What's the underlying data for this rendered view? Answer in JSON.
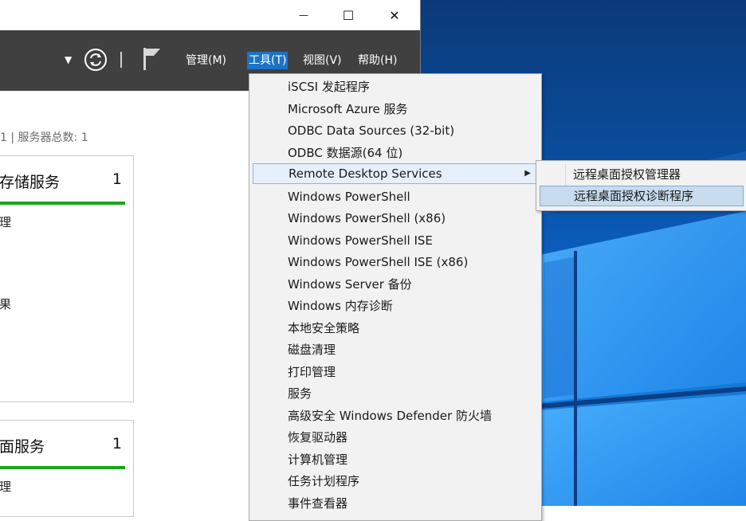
{
  "window": {
    "caption": {
      "minimize": "—",
      "maximize": "☐",
      "close": "✕"
    },
    "toolbar": {
      "dropdown_arrow": "▼",
      "menus": [
        "管理(M)",
        "工具(T)",
        "视图(V)",
        "帮助(H)"
      ],
      "active_menu": "工具(T)"
    },
    "summary_text": "1 | 服务器总数: 1",
    "cards": [
      {
        "title": "存储服务",
        "count": "1",
        "status_color": "#18a61a",
        "lines": [
          "理",
          "",
          "果"
        ]
      },
      {
        "title": "面服务",
        "count": "1",
        "status_color": "#18a61a",
        "lines": [
          "理"
        ]
      }
    ]
  },
  "tools_menu": {
    "items": [
      "iSCSI 发起程序",
      "Microsoft Azure 服务",
      "ODBC Data Sources (32-bit)",
      "ODBC 数据源(64 位)",
      "Remote Desktop Services",
      "Windows PowerShell",
      "Windows PowerShell (x86)",
      "Windows PowerShell ISE",
      "Windows PowerShell ISE (x86)",
      "Windows Server 备份",
      "Windows 内存诊断",
      "本地安全策略",
      "磁盘清理",
      "打印管理",
      "服务",
      "高级安全 Windows Defender 防火墙",
      "恢复驱动器",
      "计算机管理",
      "任务计划程序",
      "事件查看器"
    ],
    "highlighted_item": "Remote Desktop Services",
    "submenu_arrow": "▶"
  },
  "rds_submenu": {
    "items": [
      "远程桌面授权管理器",
      "远程桌面授权诊断程序"
    ],
    "highlighted_item": "远程桌面授权诊断程序"
  },
  "colors": {
    "toolbar_bg": "#404040",
    "menu_highlight": "#1c73c6",
    "status_green": "#18a61a"
  }
}
